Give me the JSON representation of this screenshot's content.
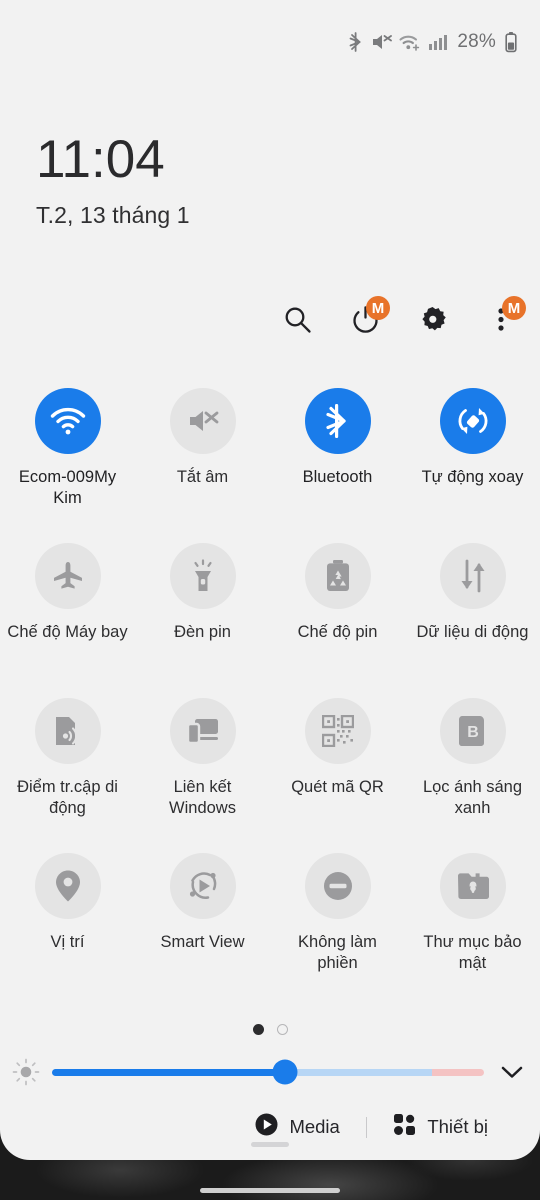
{
  "theme": {
    "panel_bg": "#f2f2f2",
    "tile_on_color": "#1a7cea",
    "tile_off_color": "#e4e4e4",
    "badge_color": "#e8732a",
    "text_color": "#2e2e30"
  },
  "status_bar": {
    "icons": [
      "bluetooth-icon",
      "volume-mute-icon",
      "wifi-plus-icon",
      "cellular-signal-icon"
    ],
    "battery_percent": "28%",
    "battery_icon": "battery-icon"
  },
  "clock": {
    "time": "11:04",
    "date": "T.2, 13 tháng 1"
  },
  "header_actions": [
    {
      "name": "search-button",
      "icon": "search-icon",
      "badge": ""
    },
    {
      "name": "power-button",
      "icon": "power-icon",
      "badge": "M"
    },
    {
      "name": "settings-button",
      "icon": "gear-icon",
      "badge": ""
    },
    {
      "name": "more-options-button",
      "icon": "three-dots-vertical-icon",
      "badge": "M"
    }
  ],
  "tiles": [
    {
      "label": "Ecom-009My Kim",
      "icon": "wifi-icon",
      "state": "on"
    },
    {
      "label": "Tắt âm",
      "icon": "volume-mute-icon",
      "state": "off"
    },
    {
      "label": "Bluetooth",
      "icon": "bluetooth-icon",
      "state": "on"
    },
    {
      "label": "Tự động xoay",
      "icon": "auto-rotate-icon",
      "state": "on"
    },
    {
      "label": "Chế độ Máy bay",
      "icon": "airplane-icon",
      "state": "off"
    },
    {
      "label": "Đèn pin",
      "icon": "flashlight-icon",
      "state": "off"
    },
    {
      "label": "Chế độ pin",
      "icon": "battery-saver-icon",
      "state": "off"
    },
    {
      "label": "Dữ liệu di động",
      "icon": "mobile-data-icon",
      "state": "off"
    },
    {
      "label": "Điểm tr.cập di động",
      "icon": "hotspot-icon",
      "state": "off"
    },
    {
      "label": "Liên kết Windows",
      "icon": "link-to-windows-icon",
      "state": "off"
    },
    {
      "label": "Quét mã QR",
      "icon": "qr-code-icon",
      "state": "off"
    },
    {
      "label": "Lọc ánh sáng xanh",
      "icon": "blue-light-filter-icon",
      "state": "off"
    },
    {
      "label": "Vị trí",
      "icon": "location-pin-icon",
      "state": "off"
    },
    {
      "label": "Smart View",
      "icon": "smart-view-icon",
      "state": "off"
    },
    {
      "label": "Không làm phiền",
      "icon": "do-not-disturb-icon",
      "state": "off"
    },
    {
      "label": "Thư mục bảo mật",
      "icon": "secure-folder-icon",
      "state": "off"
    }
  ],
  "pagination": {
    "pages": 2,
    "current": 1
  },
  "brightness": {
    "icon": "brightness-icon",
    "value_percent": 54,
    "expand_icon": "chevron-down-icon"
  },
  "bottom_bar": {
    "media_label": "Media",
    "media_icon": "play-circle-icon",
    "devices_label": "Thiết bị",
    "devices_icon": "grid-squares-icon"
  }
}
